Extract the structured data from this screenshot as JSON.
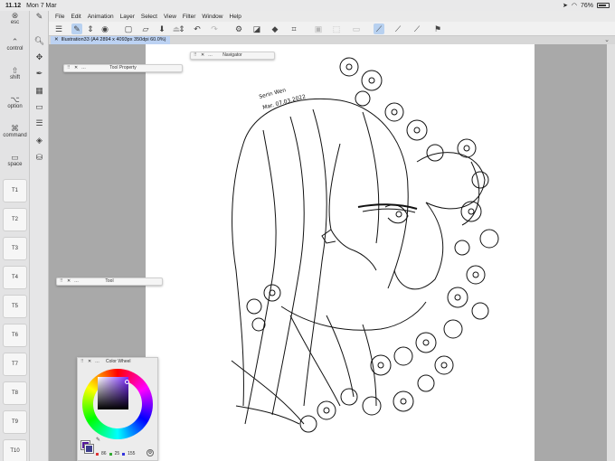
{
  "status": {
    "time": "11.12",
    "date": "Mon 7 Mar",
    "battery": "76%"
  },
  "modifiers": [
    {
      "label": "esc",
      "icon": "⊗"
    },
    {
      "label": "control",
      "icon": "⌃"
    },
    {
      "label": "shift",
      "icon": "⇧"
    },
    {
      "label": "option",
      "icon": "⌥"
    },
    {
      "label": "command",
      "icon": "⌘"
    },
    {
      "label": "space",
      "icon": "▭"
    }
  ],
  "tkeys": [
    "T1",
    "T2",
    "T3",
    "T4",
    "T5",
    "T6",
    "T7",
    "T8",
    "T9",
    "T10"
  ],
  "menu": [
    "File",
    "Edit",
    "Animation",
    "Layer",
    "Select",
    "View",
    "Filter",
    "Window",
    "Help"
  ],
  "tab": {
    "title": "Illustration33 (A4 2894 x 4093px 350dpi 60.0%)"
  },
  "palettes": {
    "tool_property": "Tool Property",
    "navigator": "Navigator",
    "tool": "Tool",
    "color_wheel": "Color Wheel"
  },
  "color": {
    "main": "#56199b",
    "r": "86",
    "g": "25",
    "b": "155"
  },
  "artwork": {
    "signature_line1": "Serin Wen",
    "signature_line2": "Mar. 07.03.2022"
  }
}
